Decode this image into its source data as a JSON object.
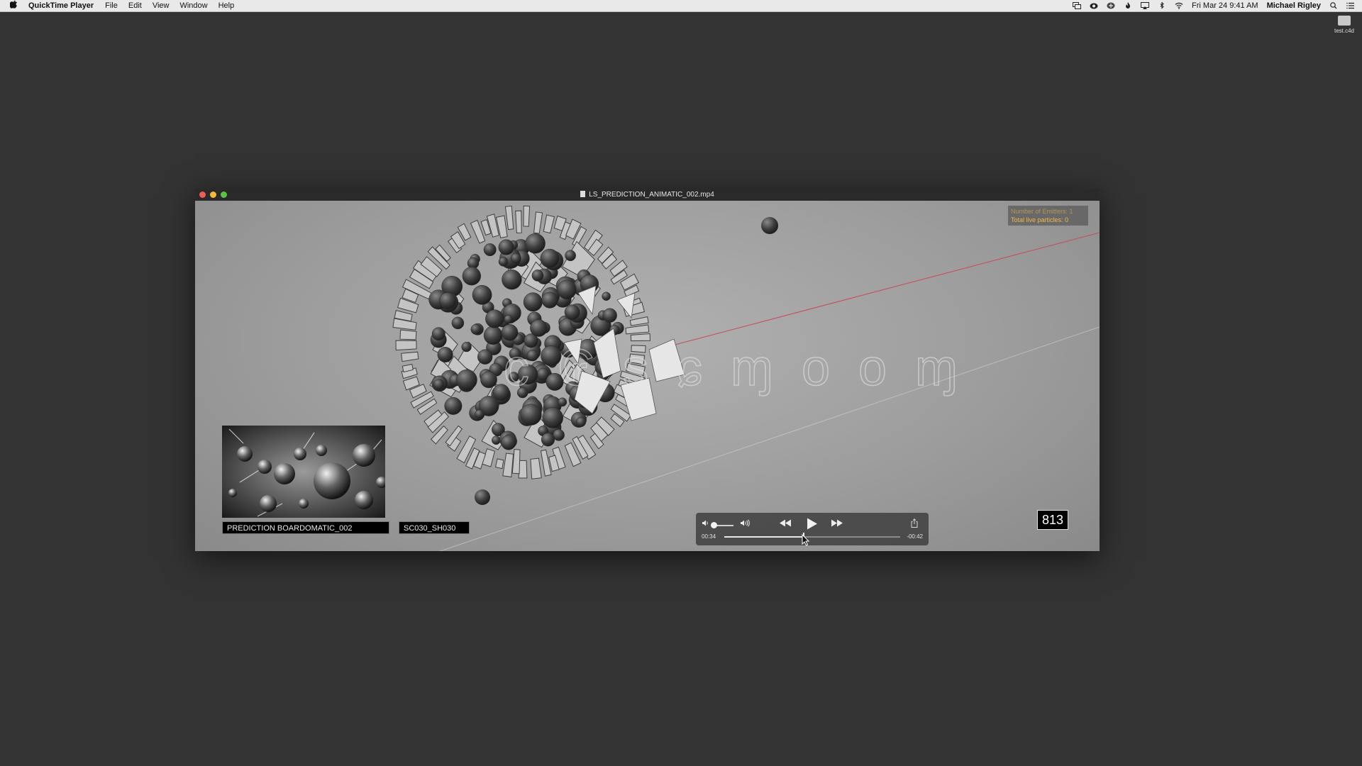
{
  "menubar": {
    "app_name": "QuickTime Player",
    "menus": [
      "File",
      "Edit",
      "View",
      "Window",
      "Help"
    ],
    "status_icons": [
      "screen-mirror-icon",
      "creative-cloud-icon",
      "cloud-sync-icon",
      "flame-icon",
      "airplay-icon",
      "bluetooth-icon",
      "wifi-icon"
    ],
    "clock": "Fri Mar 24  9:41 AM",
    "user": "Michael Rigley",
    "right_icons": [
      "spotlight-search-icon",
      "notification-center-icon"
    ]
  },
  "desktop": {
    "file_name": "test.c4d"
  },
  "window": {
    "title": "LS_PREDICTION_ANIMATIC_002.mp4"
  },
  "video": {
    "hud_line1": "Number of Emitters: 1",
    "hud_line2": "Total live particles: 0",
    "frame_counter": "813",
    "board_caption": "PREDICTION BOARDOMATIC_002",
    "shot_caption": "SC030_SH030"
  },
  "controls": {
    "time_current": "00:34",
    "time_remaining": "-00:42",
    "progress": 0.45,
    "volume": 0.05,
    "icons": [
      "volume-low-icon",
      "volume-high-icon",
      "rewind-icon",
      "play-icon",
      "fast-forward-icon",
      "share-icon"
    ]
  },
  "colors": {
    "desktop": "#333333",
    "menubar": "#e9e9e9",
    "hud_text": "#f0b94a",
    "guide_red": "#c8485a"
  }
}
